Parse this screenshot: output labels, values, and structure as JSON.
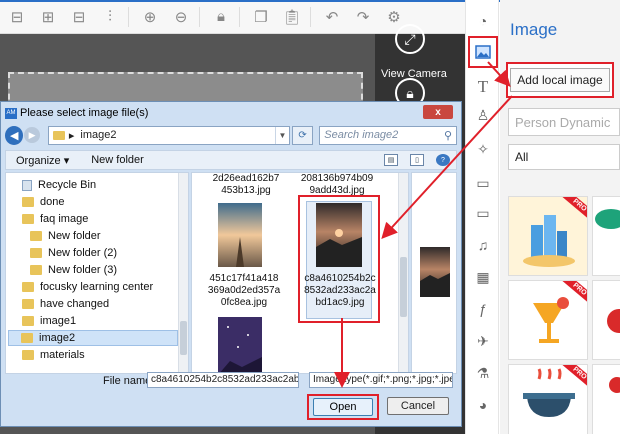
{
  "toolbar": {
    "icons": [
      "align-left-icon",
      "align-center-icon",
      "align-right-icon",
      "align-top-icon",
      "align-middle-icon",
      "zoom-in-icon",
      "zoom-out-icon",
      "lock-icon",
      "copy-icon",
      "paste-icon",
      "undo-icon",
      "redo-icon",
      "settings-icon"
    ]
  },
  "canvas": {
    "view_camera_label": "View Camera"
  },
  "side_icons": [
    "shapes-icon",
    "image-icon",
    "text-icon",
    "character-icon",
    "effect-icon",
    "chat-icon",
    "folder-icon",
    "music-icon",
    "video-icon",
    "formula-icon",
    "plane-icon",
    "chart-icon",
    "pie-icon"
  ],
  "panel": {
    "title": "Image",
    "add_local_label": "Add local image",
    "search_placeholder": "Person Dynamic",
    "filter_value": "All",
    "pro_label": "PRO"
  },
  "dialog": {
    "title": "Please select image file(s)",
    "close_label": "x",
    "address_path": "image2",
    "search_placeholder": "Search image2",
    "organize_label": "Organize",
    "new_folder_label": "New folder",
    "tree": [
      {
        "label": "Recycle Bin",
        "type": "bin"
      },
      {
        "label": "done",
        "type": "folder"
      },
      {
        "label": "faq image",
        "type": "folder"
      },
      {
        "label": "New folder",
        "type": "folder"
      },
      {
        "label": "New folder (2)",
        "type": "folder"
      },
      {
        "label": "New folder (3)",
        "type": "folder"
      },
      {
        "label": "focusky learning center",
        "type": "folder"
      },
      {
        "label": "have changed",
        "type": "folder"
      },
      {
        "label": "image1",
        "type": "folder"
      },
      {
        "label": "image2",
        "type": "folder",
        "selected": true
      },
      {
        "label": "materials",
        "type": "folder"
      }
    ],
    "files": [
      {
        "caption": "2d26ead162b7\n453b13.jpg"
      },
      {
        "caption": "208136b974b09\n9add43d.jpg"
      },
      {
        "caption": "451c17f41a418\n369a0d2ed357a\n0fc8ea.jpg"
      },
      {
        "caption": "c8a4610254b2c\n8532ad233ac2a\nbd1ac9.jpg",
        "selected": true
      },
      {
        "caption": ""
      }
    ],
    "file_name_label": "File name:",
    "file_name_value": "c8a4610254b2c8532ad233ac2abd1a",
    "file_type_value": "Image type(*.gif;*.png;*.jpg;*.jpe",
    "open_label": "Open",
    "cancel_label": "Cancel"
  },
  "colors": {
    "accent": "#2a6fc7",
    "highlight": "#e0202a"
  }
}
